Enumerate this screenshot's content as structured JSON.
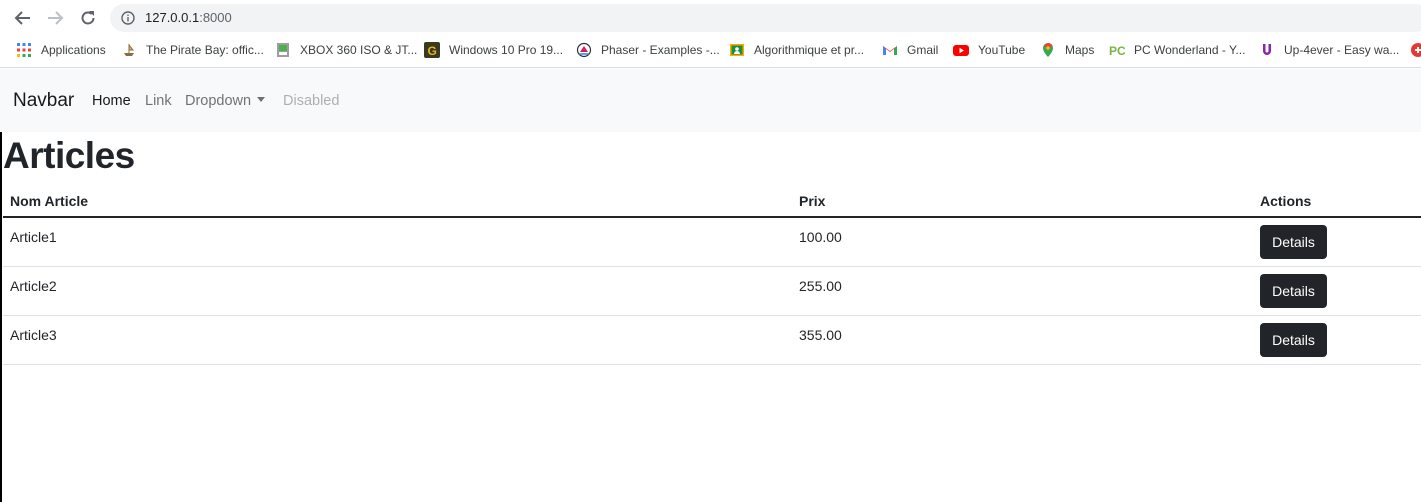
{
  "browser": {
    "url_host": "127.0.0.1",
    "url_port": ":8000",
    "bookmarks": [
      {
        "label": "Applications",
        "icon": "apps-grid-icon"
      },
      {
        "label": "The Pirate Bay: offic...",
        "icon": "pirate-ship-icon"
      },
      {
        "label": "XBOX 360 ISO & JT...",
        "icon": "xbox-site-icon"
      },
      {
        "label": "Windows 10 Pro 19...",
        "icon": "g-logo-icon"
      },
      {
        "label": "Phaser - Examples -...",
        "icon": "phaser-icon"
      },
      {
        "label": "Algorithmique et pr...",
        "icon": "classroom-icon"
      },
      {
        "label": "Gmail",
        "icon": "gmail-icon"
      },
      {
        "label": "YouTube",
        "icon": "youtube-icon"
      },
      {
        "label": "Maps",
        "icon": "maps-pin-icon"
      },
      {
        "label": "PC Wonderland - Y...",
        "icon": "pc-wonderland-icon"
      },
      {
        "label": "Up-4ever - Easy wa...",
        "icon": "up4ever-icon"
      }
    ]
  },
  "navbar": {
    "brand": "Navbar",
    "links": [
      {
        "label": "Home",
        "state": "active"
      },
      {
        "label": "Link",
        "state": "normal"
      },
      {
        "label": "Dropdown",
        "state": "dropdown"
      },
      {
        "label": "Disabled",
        "state": "disabled"
      }
    ]
  },
  "page": {
    "title": "Articles"
  },
  "table": {
    "headers": [
      "Nom Article",
      "Prix",
      "Actions"
    ],
    "rows": [
      {
        "name": "Article1",
        "price": "100.00",
        "action": "Details"
      },
      {
        "name": "Article2",
        "price": "255.00",
        "action": "Details"
      },
      {
        "name": "Article3",
        "price": "355.00",
        "action": "Details"
      }
    ]
  },
  "colors": {
    "navbar_bg": "#f8f9fa",
    "button_dark": "#212529",
    "omnibox_bg": "#f1f3f4"
  }
}
